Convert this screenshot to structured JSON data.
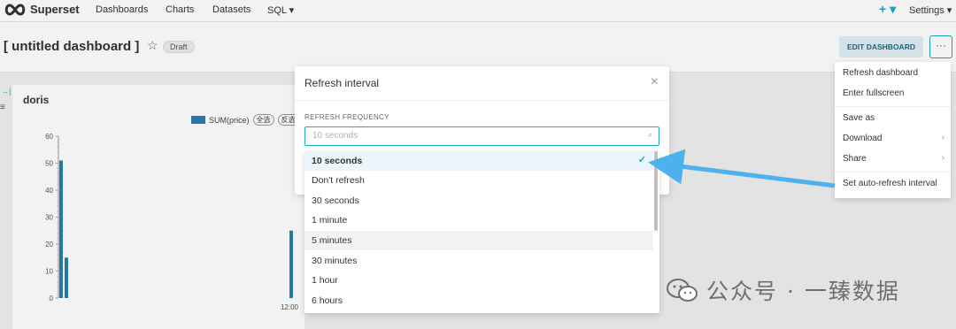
{
  "nav": {
    "brand": "Superset",
    "links": [
      "Dashboards",
      "Charts",
      "Datasets",
      "SQL ▾"
    ],
    "plus": "+ ▾",
    "settings": "Settings ▾"
  },
  "dashboard": {
    "title": "[ untitled dashboard ]",
    "status": "Draft",
    "edit_button": "EDIT DASHBOARD",
    "more_button": "···"
  },
  "chart_data": {
    "type": "bar",
    "title": "doris",
    "series": [
      {
        "name": "SUM(price)",
        "values": [
          51,
          15,
          25
        ]
      }
    ],
    "legend_pills": [
      "全选",
      "反选"
    ],
    "ylim": [
      0,
      60
    ],
    "yticks": [
      "0",
      "10",
      "20",
      "30",
      "40",
      "50",
      "60"
    ],
    "xticks": [
      "12:00"
    ],
    "color": "#2a7fb0"
  },
  "modal": {
    "title": "Refresh interval",
    "close": "×",
    "label": "REFRESH FREQUENCY",
    "placeholder": "10 seconds",
    "search_icon": "search-icon"
  },
  "dropdown": {
    "options": [
      "10 seconds",
      "Don't refresh",
      "30 seconds",
      "1 minute",
      "5 minutes",
      "30 minutes",
      "1 hour",
      "6 hours"
    ],
    "selected": "10 seconds",
    "check": "✓"
  },
  "menu": {
    "items": [
      "Refresh dashboard",
      "Enter fullscreen",
      "Save as",
      "Download",
      "Share",
      "Set auto-refresh interval"
    ],
    "chevron": "›"
  },
  "annotation": {
    "arrow_color": "#4db1ee"
  },
  "watermark": {
    "text": "公众号 · 一臻数据"
  },
  "colors": {
    "accent": "#1fa8c9",
    "bar": "#2a7fb0"
  }
}
